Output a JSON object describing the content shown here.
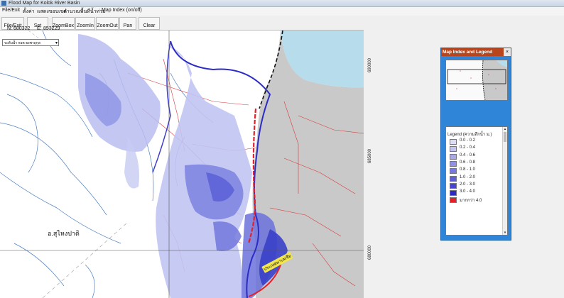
{
  "window": {
    "title": "Flood Map for Kolok River Basin"
  },
  "menu": [
    "File/Exit",
    "ตั้งค่า",
    "แสดงขอบเขต",
    "คำนวณพื้นที่น้ำท่วม",
    "Map Index (on/off)"
  ],
  "toolbar": {
    "file_exit": "File/Exit",
    "set_scale": "Set Scale",
    "zoom_box": "ZoomBox",
    "zoom_in": "ZoomIn",
    "zoom_out": "ZoomOut",
    "pan": "Pan",
    "clear": "Clear"
  },
  "coords": {
    "n_label": "N:",
    "n_value": "680322",
    "e_label": "E:",
    "e_value": "853229"
  },
  "layer_select": {
    "value": "ระดับน้ำ กอต ธงชาฤกุล"
  },
  "map": {
    "district_label": "อ.สุไหงปาดิ",
    "road_label": "ประเทศมาเลเซีย",
    "grid_labels": [
      "690000",
      "685000",
      "680000"
    ]
  },
  "panel": {
    "title": "Map Index and Legend",
    "legend_title": "Legend (ความลึกน้ำ ม.)",
    "legend": [
      {
        "label": "0.0 - 0.2",
        "color": "#dcdcf7"
      },
      {
        "label": "0.2 - 0.4",
        "color": "#c3c3f1"
      },
      {
        "label": "0.4 - 0.6",
        "color": "#a9a9ea"
      },
      {
        "label": "0.6 - 0.8",
        "color": "#9090e4"
      },
      {
        "label": "0.8 - 1.0",
        "color": "#7878de"
      },
      {
        "label": "1.0 - 2.0",
        "color": "#5f5fd8"
      },
      {
        "label": "2.0 - 3.0",
        "color": "#4646d0"
      },
      {
        "label": "3.0 - 4.0",
        "color": "#2d2dc5"
      },
      {
        "label": "มากกว่า 4.0",
        "color": "#e4202a"
      }
    ]
  }
}
